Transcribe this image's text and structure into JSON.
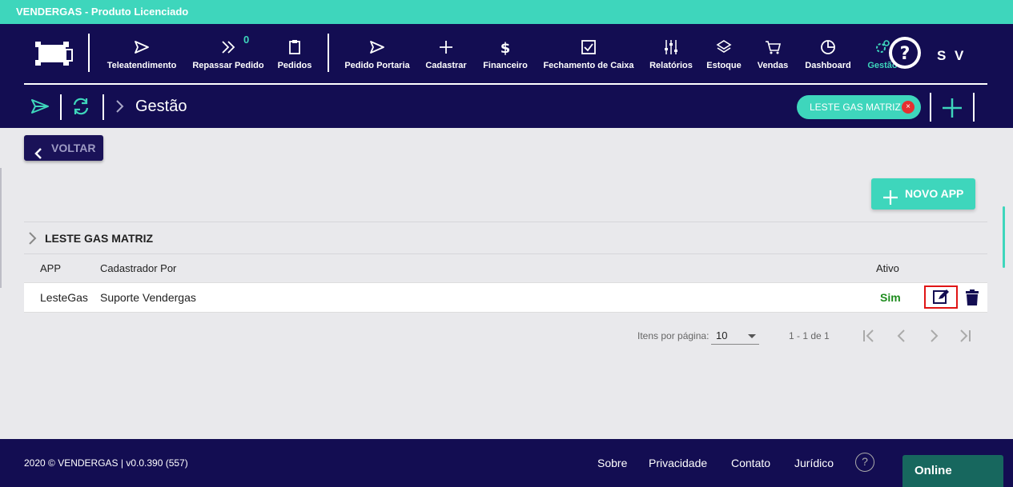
{
  "license_bar": {
    "title": "VENDERGAS - Produto Licenciado"
  },
  "nav": {
    "items": [
      {
        "label": "Teleatendimento",
        "icon": "send-icon"
      },
      {
        "label": "Repassar Pedido",
        "icon": "double-chevron-right-icon",
        "badge": "0"
      },
      {
        "label": "Pedidos",
        "icon": "clipboard-icon"
      },
      {
        "label": "Pedido Portaria",
        "icon": "send-icon"
      },
      {
        "label": "Cadastrar",
        "icon": "plus-icon"
      },
      {
        "label": "Financeiro",
        "icon": "dollar-icon"
      },
      {
        "label": "Fechamento de Caixa",
        "icon": "checkbox-icon"
      },
      {
        "label": "Relatórios",
        "icon": "sliders-icon"
      },
      {
        "label": "Estoque",
        "icon": "layers-icon"
      },
      {
        "label": "Vendas",
        "icon": "cart-icon"
      },
      {
        "label": "Dashboard",
        "icon": "pie-chart-icon"
      },
      {
        "label": "Gestão",
        "icon": "gears-icon"
      }
    ],
    "user_initials": "S V"
  },
  "subbar": {
    "breadcrumb": "Gestão",
    "store": "LESTE GAS MATRIZ",
    "store_remove": "×"
  },
  "actions": {
    "back": "VOLTAR",
    "new_app": "NOVO APP"
  },
  "group": {
    "title": "LESTE GAS MATRIZ",
    "columns": {
      "app": "APP",
      "cadastrador": "Cadastrador Por",
      "ativo": "Ativo"
    },
    "rows": [
      {
        "app": "LesteGas",
        "cadastrador": "Suporte Vendergas",
        "ativo": "Sim"
      }
    ]
  },
  "paginator": {
    "items_per_page_label": "Itens por página:",
    "items_per_page": "10",
    "range": "1 - 1 de 1"
  },
  "footer": {
    "copyright": "2020 © VENDERGAS | v0.0.390 (557)",
    "links": [
      "Sobre",
      "Privacidade",
      "Contato",
      "Jurídico"
    ],
    "help": "?",
    "chat_status": "Online"
  },
  "colors": {
    "navy": "#130d52",
    "teal": "#3ed6bc",
    "active_green": "#1e8c1e",
    "highlight_red": "#e01515"
  }
}
